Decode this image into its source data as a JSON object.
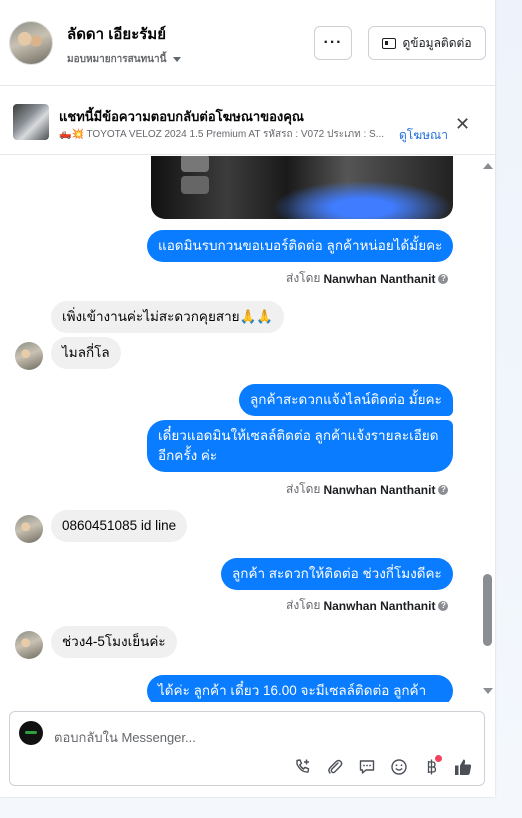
{
  "header": {
    "contact_name": "ลัดดา เอียะรัมย์",
    "assign_label": "มอบหมายการสนทนานี้",
    "more_label": "···",
    "contact_info_label": "ดูข้อมูลติดต่อ"
  },
  "ad": {
    "title": "แชทนี้มีข้อความตอบกลับต่อโฆษณาของคุณ",
    "subtitle": "🛻💥 TOYOTA VELOZ 2024 1.5 Premium AT รหัสรถ : V072 ประเภท : S...",
    "link": "ดูโฆษณา",
    "close": "✕"
  },
  "messages": {
    "m1": "แอดมินรบกวนขอเบอร์ติดต่อ ลูกค้าหน่อยได้มั้ยคะ",
    "m2": "เพิ่งเข้างานค่ะไม่สะดวกคุยสาย🙏🙏",
    "m3": "ไมลกี่โล",
    "m4": "ลูกค้าสะดวกแจ้งไลน์ติดต่อ มั้ยคะ",
    "m5_line1": "เดี๋ยวแอดมินให้เซลล์ติดต่อ ลูกค้าแจ้งรายละเอียด",
    "m5_line2": "อีกครั้ง ค่ะ",
    "m6": "0860451085 id line",
    "m7": "ลูกค้า สะดวกให้ติดต่อ ช่วงกี่โมงดีคะ",
    "m8": "ช่วง4-5โมงเย็นค่ะ",
    "m9": "ได้ค่ะ  ลูกค้า เดี๋ยว 16.00 จะมีเซลล์ติดต่อ ลูกค้า"
  },
  "sent_by": {
    "prefix": "ส่งโดย",
    "name": "Nanwhan Nanthanit",
    "info": "?"
  },
  "composer": {
    "placeholder": "ตอบกลับใน Messenger..."
  },
  "icons": {
    "call": "call-add-icon",
    "attach": "paperclip-icon",
    "saved_reply": "chat-bubble-icon",
    "emoji": "emoji-icon",
    "payment": "baht-icon",
    "like": "thumbs-up-icon"
  },
  "colors": {
    "outgoing_bubble": "#0a7cff",
    "incoming_bubble": "#f0f0f0",
    "link": "#216fdb"
  }
}
